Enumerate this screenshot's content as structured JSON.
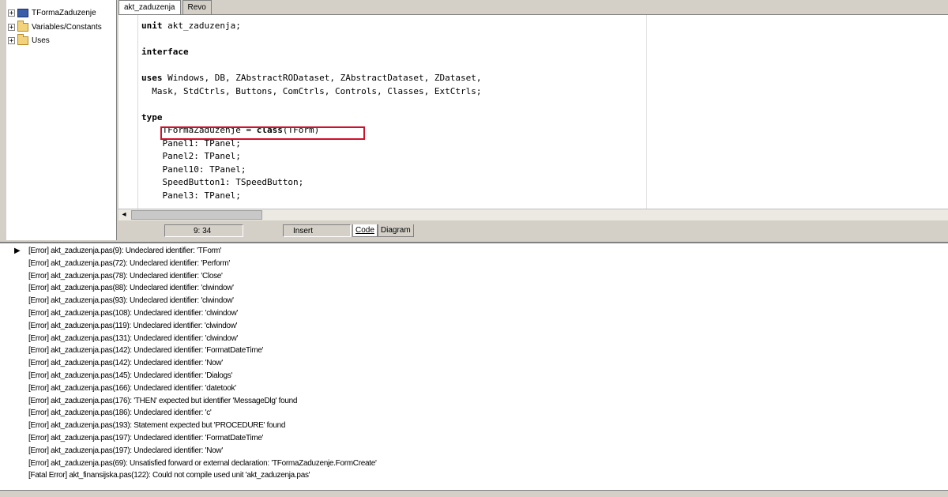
{
  "tree": {
    "items": [
      {
        "label": "TFormaZaduzenje",
        "expander": "+",
        "icon": "form-icon"
      },
      {
        "label": "Variables/Constants",
        "expander": "+",
        "icon": "folder-icon"
      },
      {
        "label": "Uses",
        "expander": "+",
        "icon": "folder-icon"
      }
    ]
  },
  "editor": {
    "tabs": [
      {
        "label": "akt_zaduzenja",
        "active": true
      },
      {
        "label": "Revo",
        "active": false
      }
    ],
    "code_lines": [
      "unit akt_zaduzenja;",
      "",
      "interface",
      "",
      "uses Windows, DB, ZAbstractRODataset, ZAbstractDataset, ZDataset,",
      "  Mask, StdCtrls, Buttons, ComCtrls, Controls, Classes, ExtCtrls;",
      "",
      "type",
      "    TFormaZaduzenje = class(TForm)",
      "    Panel1: TPanel;",
      "    Panel2: TPanel;",
      "    Panel10: TPanel;",
      "    SpeedButton1: TSpeedButton;",
      "    Panel3: TPanel;"
    ]
  },
  "statusbar": {
    "position": "9: 34",
    "mode": "Insert",
    "tabs": [
      {
        "label": "Code",
        "active": true
      },
      {
        "label": "Diagram",
        "active": false
      }
    ]
  },
  "messages": [
    "[Error] akt_zaduzenja.pas(9): Undeclared identifier: 'TForm'",
    "[Error] akt_zaduzenja.pas(72): Undeclared identifier: 'Perform'",
    "[Error] akt_zaduzenja.pas(78): Undeclared identifier: 'Close'",
    "[Error] akt_zaduzenja.pas(88): Undeclared identifier: 'clwindow'",
    "[Error] akt_zaduzenja.pas(93): Undeclared identifier: 'clwindow'",
    "[Error] akt_zaduzenja.pas(108): Undeclared identifier: 'clwindow'",
    "[Error] akt_zaduzenja.pas(119): Undeclared identifier: 'clwindow'",
    "[Error] akt_zaduzenja.pas(131): Undeclared identifier: 'clwindow'",
    "[Error] akt_zaduzenja.pas(142): Undeclared identifier: 'FormatDateTime'",
    "[Error] akt_zaduzenja.pas(142): Undeclared identifier: 'Now'",
    "[Error] akt_zaduzenja.pas(145): Undeclared identifier: 'Dialogs'",
    "[Error] akt_zaduzenja.pas(166): Undeclared identifier: 'datetook'",
    "[Error] akt_zaduzenja.pas(176): 'THEN' expected but identifier 'MessageDlg' found",
    "[Error] akt_zaduzenja.pas(186): Undeclared identifier: 'c'",
    "[Error] akt_zaduzenja.pas(193): Statement expected but 'PROCEDURE' found",
    "[Error] akt_zaduzenja.pas(197): Undeclared identifier: 'FormatDateTime'",
    "[Error] akt_zaduzenja.pas(197): Undeclared identifier: 'Now'",
    "[Error] akt_zaduzenja.pas(69): Unsatisfied forward or external declaration: 'TFormaZaduzenje.FormCreate'",
    "[Fatal Error] akt_finansijska.pas(122): Could not compile used unit 'akt_zaduzenja.pas'"
  ],
  "colors": {
    "highlight_box": "#d0102a",
    "window_bg": "#d4d0c8"
  }
}
